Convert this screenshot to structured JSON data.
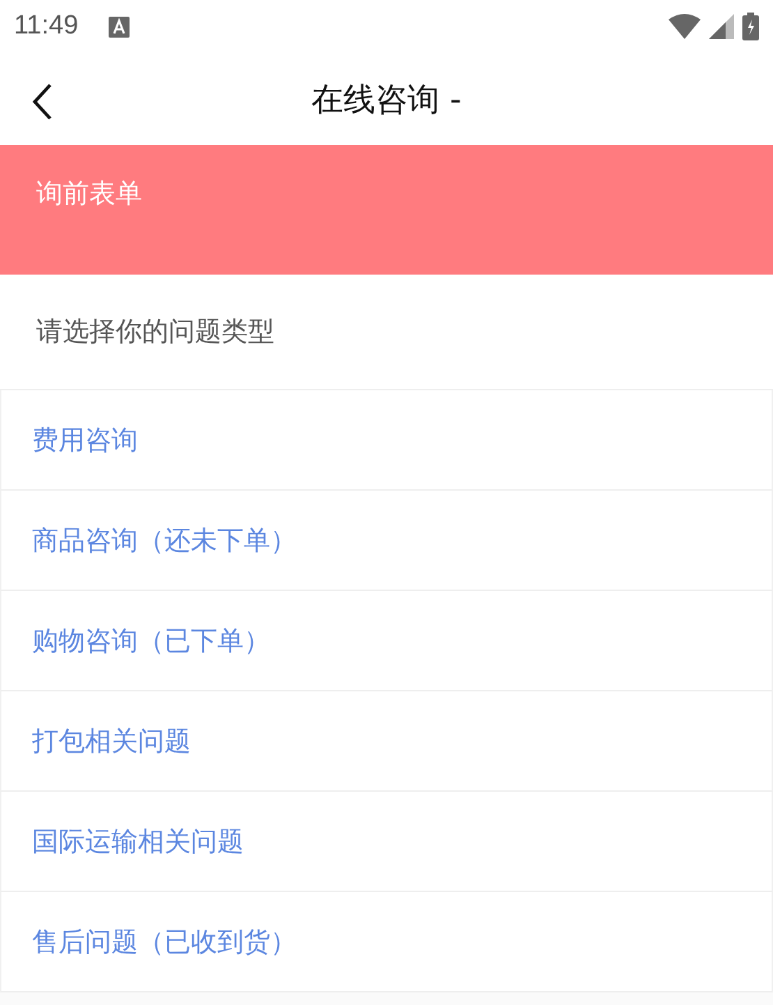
{
  "status_bar": {
    "time": "11:49"
  },
  "header": {
    "title": "在线咨询 -"
  },
  "banner": {
    "title": "询前表单"
  },
  "prompt": "请选择你的问题类型",
  "options": [
    "费用咨询",
    "商品咨询（还未下单）",
    "购物咨询（已下单）",
    "打包相关问题",
    "国际运输相关问题",
    "售后问题（已收到货）"
  ]
}
